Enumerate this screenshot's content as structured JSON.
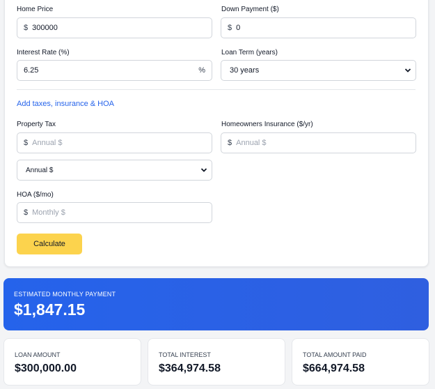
{
  "form": {
    "home_price": {
      "label": "Home Price",
      "prefix": "$",
      "value": "300000"
    },
    "down_payment": {
      "label": "Down Payment ($)",
      "prefix": "$",
      "value": "0"
    },
    "interest_rate": {
      "label": "Interest Rate (%)",
      "value": "6.25",
      "suffix": "%"
    },
    "loan_term": {
      "label": "Loan Term (years)",
      "selected": "30 years"
    },
    "extras_link": "Add taxes, insurance & HOA",
    "property_tax": {
      "label": "Property Tax",
      "prefix": "$",
      "placeholder": "Annual $"
    },
    "property_tax_mode": {
      "selected": "Annual $"
    },
    "insurance": {
      "label": "Homeowners Insurance ($/yr)",
      "prefix": "$",
      "placeholder": "Annual $"
    },
    "hoa": {
      "label": "HOA ($/mo)",
      "prefix": "$",
      "placeholder": "Monthly $"
    },
    "calculate_label": "Calculate"
  },
  "results": {
    "monthly": {
      "title": "ESTIMATED MONTHLY PAYMENT",
      "value": "$1,847.15"
    },
    "loan_amount": {
      "title": "LOAN AMOUNT",
      "value": "$300,000.00"
    },
    "total_interest": {
      "title": "TOTAL INTEREST",
      "value": "$364,974.58"
    },
    "total_paid": {
      "title": "TOTAL AMOUNT PAID",
      "value": "$664,974.58"
    }
  },
  "colors": {
    "accent": "#2563eb",
    "button": "#fcd34d",
    "link": "#2563eb"
  }
}
